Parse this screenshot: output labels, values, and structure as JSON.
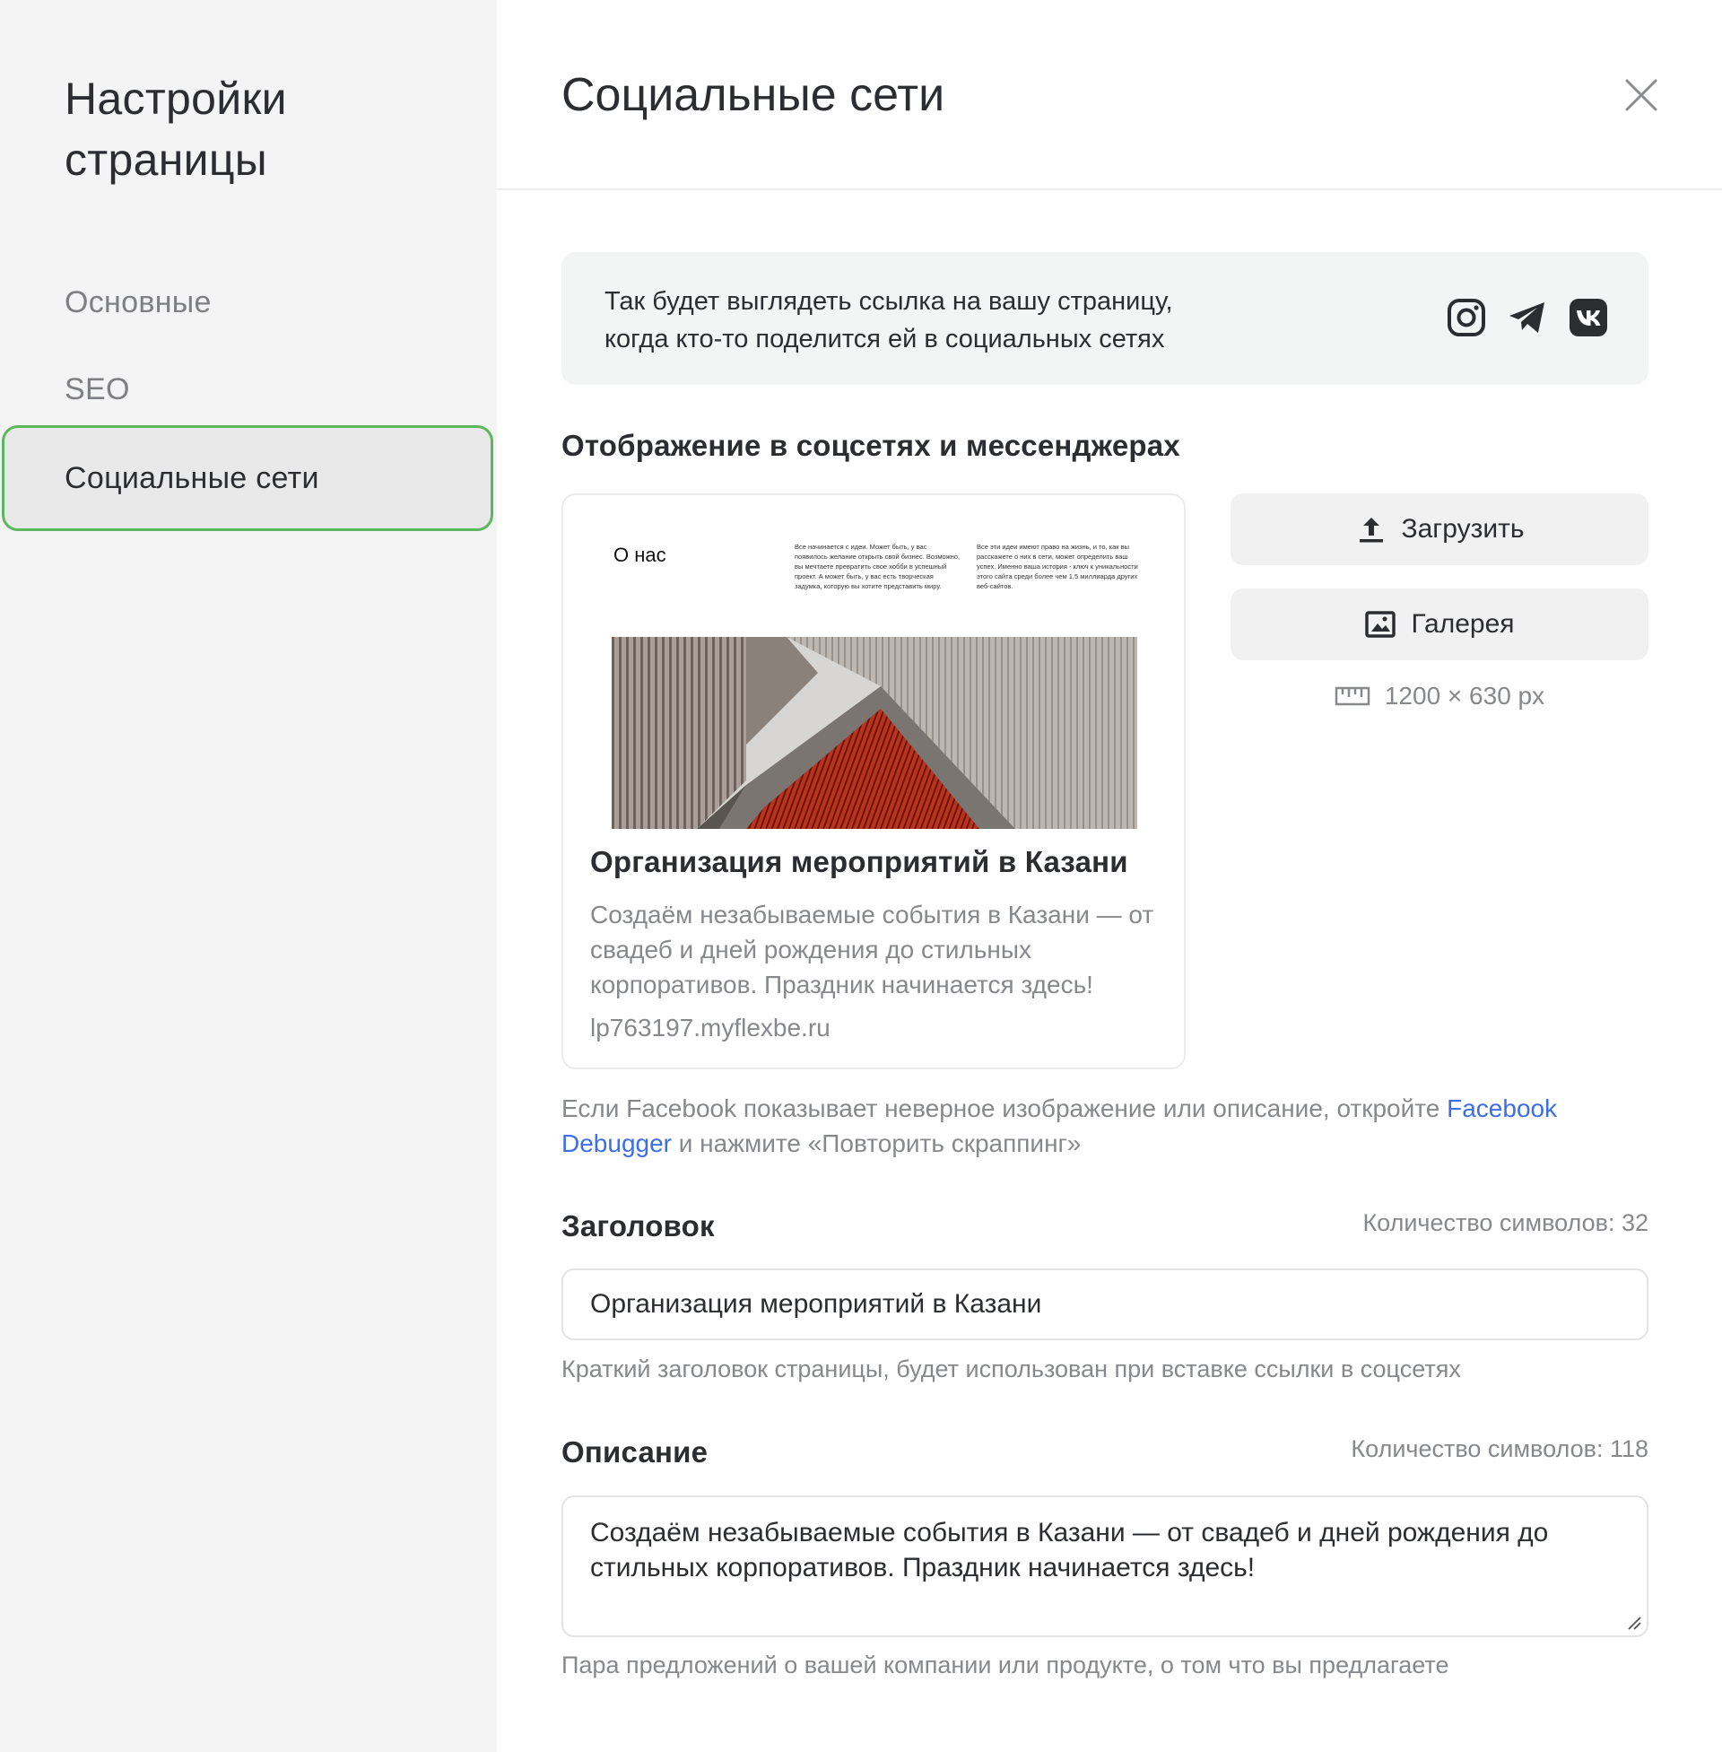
{
  "sidebar": {
    "title_line1": "Настройки",
    "title_line2": "страницы",
    "items": [
      {
        "label": "Основные"
      },
      {
        "label": "SEO"
      },
      {
        "label": "Социальные сети",
        "active": true
      }
    ],
    "active_border_color": "#5cb85c"
  },
  "main": {
    "title": "Социальные сети",
    "close_icon": "close-icon",
    "info": {
      "line1": "Так будет выглядеть ссылка на вашу страницу,",
      "line2": "когда кто-то поделится ей в социальных сетях",
      "icons": [
        "instagram-icon",
        "telegram-icon",
        "vk-icon"
      ]
    },
    "section_title": "Отображение в соцсетях и мессенджерах",
    "preview": {
      "thumb_heading": "О нас",
      "thumb_col1": "Все начинается с идеи. Может быть, у вас появилось желание открыть свой бизнес. Возможно, вы мечтаете превратить свое хобби в успешный проект. А может быть, у вас есть творческая задумка, которую вы хотите представить миру.",
      "thumb_col2": "Все эти идеи имеют право на жизнь, и то, как вы расскажете о них в сети, может определить ваш успех. Именно ваша история - ключ к уникальности этого сайта среди более чем 1,5 миллиарда других веб-сайтов.",
      "title": "Организация мероприятий в Казани",
      "description": "Создаём незабываемые события в Казани — от свадеб и дней рождения до стильных корпоративов. Праздник начинается здесь!",
      "url": "lp763197.myflexbe.ru"
    },
    "buttons": {
      "upload_label": "Загрузить",
      "gallery_label": "Галерея"
    },
    "image_size": "1200 × 630 px",
    "fb_note": {
      "before": "Если Facebook показывает неверное изображение или описание, откройте ",
      "link": "Facebook Debugger",
      "after": " и нажмите «Повторить скраппинг»",
      "link_color": "#3d6ee6"
    },
    "title_field": {
      "label": "Заголовок",
      "count": "Количество символов: 32",
      "value": "Организация мероприятий в Казани",
      "hint": "Краткий заголовок страницы, будет использован при вставке ссылки в соцсетях"
    },
    "desc_field": {
      "label": "Описание",
      "count": "Количество символов: 118",
      "value": "Создаём незабываемые события в Казани — от свадеб и дней рождения до стильных корпоративов. Праздник начинается здесь!",
      "hint": "Пара предложений о вашей компании или продукте, о том что вы предлагаете"
    }
  }
}
